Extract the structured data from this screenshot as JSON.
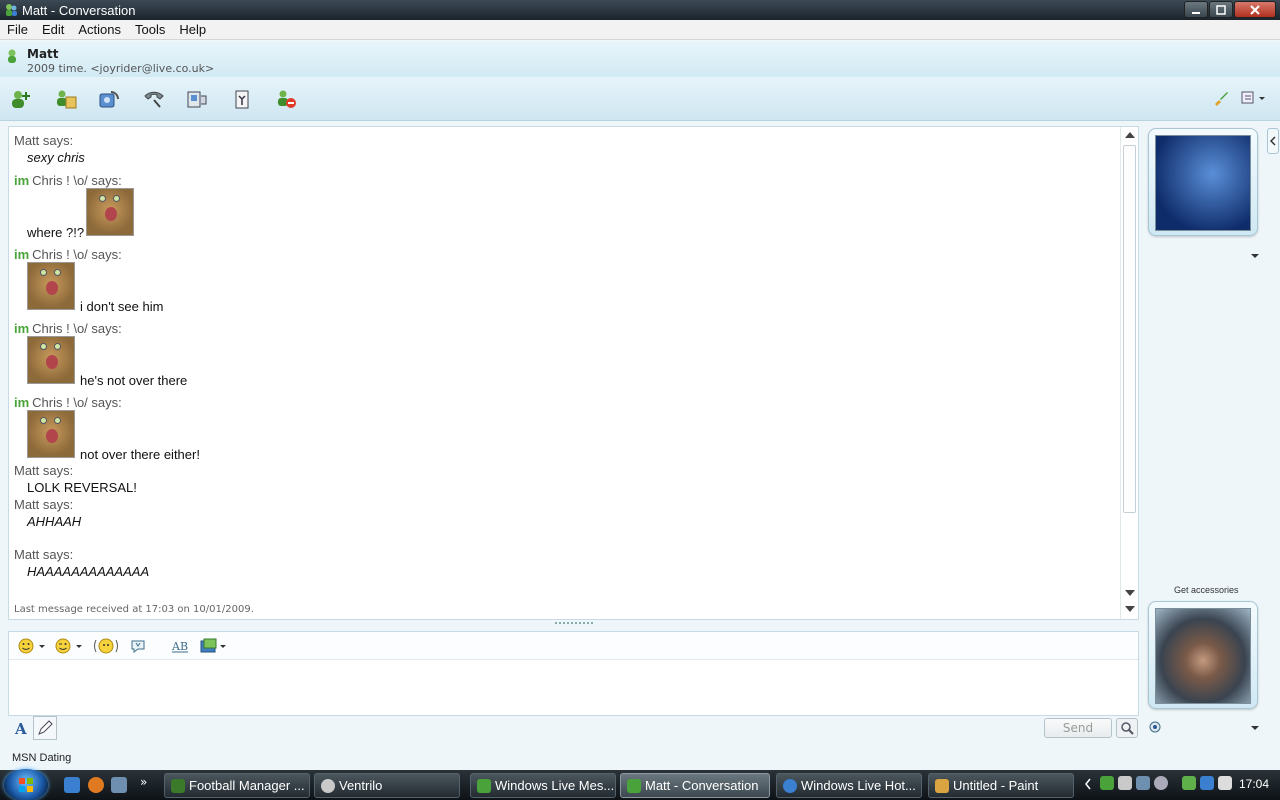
{
  "window": {
    "title": "Matt - Conversation"
  },
  "menu": [
    "File",
    "Edit",
    "Actions",
    "Tools",
    "Help"
  ],
  "contact": {
    "name": "Matt",
    "status": "2009 time.  <joyrider@live.co.uk>"
  },
  "toolbar": {
    "icons": [
      "invite-contact-icon",
      "share-files-icon",
      "video-call-icon",
      "call-icon",
      "games-icon",
      "activities-icon",
      "block-icon"
    ],
    "right_icons": [
      "paint-brush-icon",
      "show-menu-icon"
    ]
  },
  "conversation": {
    "m1_sender": "Matt says:",
    "m1_text": "sexy chris",
    "m2_sender": "Chris ! \\o/ says:",
    "m2_text": "where ?!?",
    "m3_sender": "Chris ! \\o/ says:",
    "m3_text": "i don't see him",
    "m4_sender": "Chris ! \\o/ says:",
    "m4_text": "he's not over there",
    "m5_sender": "Chris ! \\o/ says:",
    "m5_text": "not over there either!",
    "m6_sender": "Matt says:",
    "m6_text": "LOLK REVERSAL!",
    "m7_sender": "Matt says:",
    "m7_text": "AHHAAH",
    "m8_sender": "Matt says:",
    "m8_text": "HAAAAAAAAAAAAA",
    "im_badge": "im",
    "last_received": "Last message received at 17:03 on 10/01/2009."
  },
  "compose": {
    "send_label": "Send",
    "format_icons": [
      "emoticon-icon",
      "wink-icon",
      "nudge-icon",
      "voice-clip-icon",
      "handwriting-icon",
      "background-icon"
    ],
    "font_icon": "font-icon",
    "handwrite_icon": "handwrite-icon"
  },
  "side_panel": {
    "get_accessories": "Get accessories"
  },
  "ad_text": "MSN Dating",
  "taskbar": {
    "items": [
      {
        "label": "Football Manager ...",
        "color": "#3b7a2a"
      },
      {
        "label": "Ventrilo",
        "color": "#c9c9c9"
      },
      {
        "label": "Windows Live Mes...",
        "color": "#4aa33a"
      },
      {
        "label": "Matt - Conversation",
        "color": "#4aa33a"
      },
      {
        "label": "Windows Live Hot...",
        "color": "#3a7fd0"
      },
      {
        "label": "Untitled - Paint",
        "color": "#d9a441"
      }
    ],
    "clock": "17:04"
  }
}
